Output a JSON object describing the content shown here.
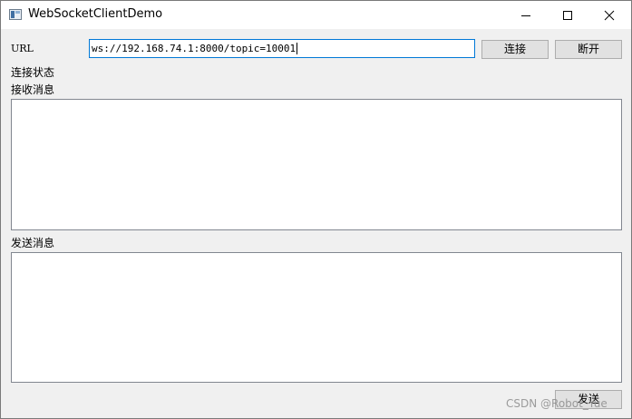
{
  "window": {
    "title": "WebSocketClientDemo"
  },
  "form": {
    "url_label": "URL",
    "url_value": "ws://192.168.74.1:8000/topic=10001",
    "connect_label": "连接",
    "disconnect_label": "断开",
    "status_label": "连接状态",
    "receive_label": "接收消息",
    "send_section_label": "发送消息",
    "send_button_label": "发送"
  },
  "watermark": "CSDN @Robot_Yue",
  "icons": [
    "app-icon",
    "minimize-icon",
    "maximize-icon",
    "close-icon"
  ],
  "colors": {
    "focus_border": "#0078d7",
    "window_bg": "#f0f0f0",
    "button_bg": "#e1e1e1"
  }
}
